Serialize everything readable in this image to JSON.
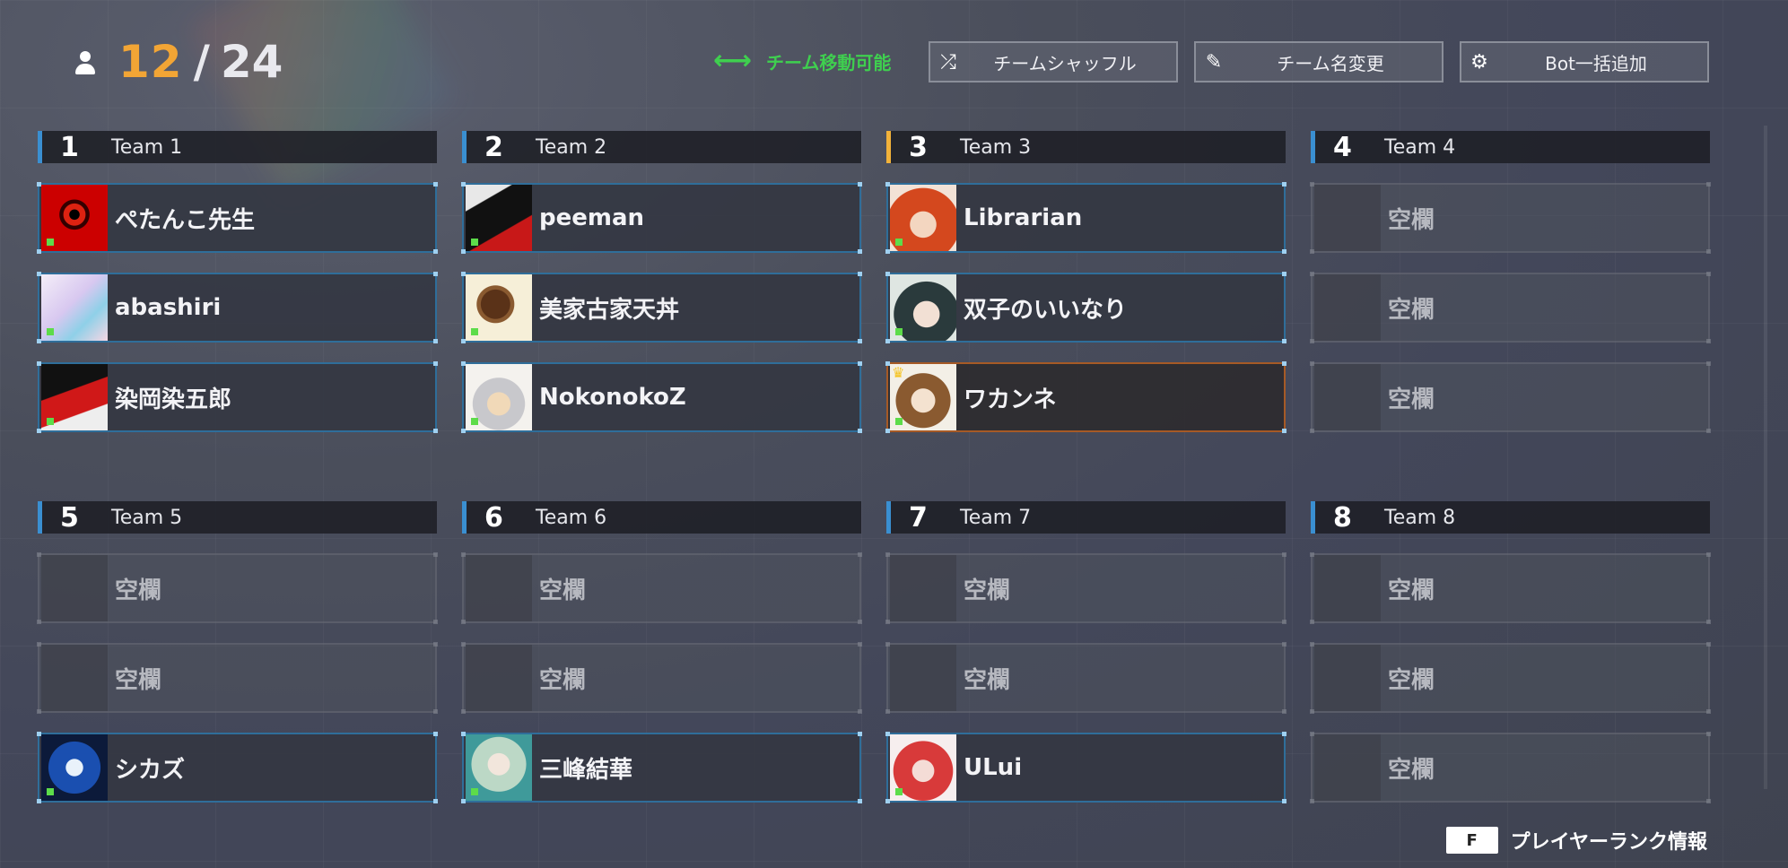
{
  "header": {
    "player_count": "12",
    "separator": "/",
    "max_players": "24",
    "move_status": "チーム移動可能",
    "buttons": {
      "shuffle": "チームシャッフル",
      "rename": "チーム名変更",
      "add_bots": "Bot一括追加"
    }
  },
  "teams": [
    {
      "number": "1",
      "name": "Team 1",
      "players": [
        "ぺたんこ先生",
        "abashiri",
        "染岡染五郎"
      ]
    },
    {
      "number": "2",
      "name": "Team 2",
      "players": [
        "peeman",
        "美家古家天丼",
        "NokonokoZ"
      ]
    },
    {
      "number": "3",
      "name": "Team 3",
      "players": [
        "Librarian",
        "双子のいいなり",
        "ワカンネ"
      ]
    },
    {
      "number": "4",
      "name": "Team 4",
      "players": [
        "空欄",
        "空欄",
        "空欄"
      ]
    },
    {
      "number": "5",
      "name": "Team 5",
      "players": [
        "空欄",
        "空欄",
        "シカズ"
      ]
    },
    {
      "number": "6",
      "name": "Team 6",
      "players": [
        "空欄",
        "空欄",
        "三峰結華"
      ]
    },
    {
      "number": "7",
      "name": "Team 7",
      "players": [
        "空欄",
        "空欄",
        "ULui"
      ]
    },
    {
      "number": "8",
      "name": "Team 8",
      "players": [
        "空欄",
        "空欄",
        "空欄"
      ]
    }
  ],
  "footer": {
    "key": "F",
    "label": "プレイヤーランク情報"
  },
  "colors": {
    "accent_orange": "#f2a535",
    "move_green": "#3fcf4f",
    "team_marker_blue": "#3a8fd1",
    "team_marker_gold": "#f2b23a"
  },
  "icons": {
    "count": "user-icon",
    "move": "double-arrow-icon",
    "shuffle": "shuffle-icon",
    "rename": "pencil-icon",
    "add_bots": "bot-icon"
  }
}
